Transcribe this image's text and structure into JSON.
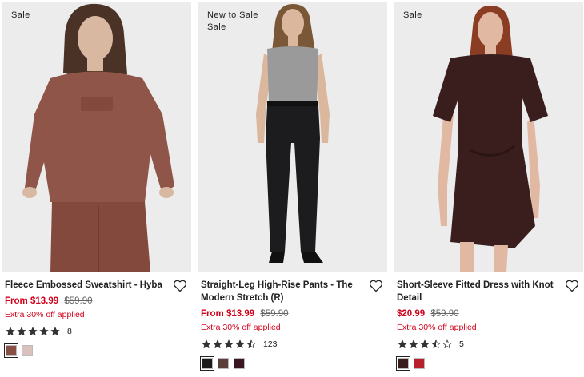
{
  "products": [
    {
      "badges": [
        "Sale"
      ],
      "title": "Fleece Embossed Sweatshirt - Hyba",
      "price_sale": "From $13.99",
      "price_original": "$59.90",
      "promo": "Extra 30% off applied",
      "rating": 5,
      "review_count": "8",
      "swatches": [
        "#8a4f44",
        "#d9c2bd"
      ],
      "image_icon": "model-photo",
      "colors": {
        "garment": "#8e5548",
        "skin": "#d9b8a2",
        "hair": "#4a3326"
      }
    },
    {
      "badges": [
        "New to Sale",
        "Sale"
      ],
      "title": "Straight-Leg High-Rise Pants - The Modern Stretch (R)",
      "price_sale": "From $13.99",
      "price_original": "$59.90",
      "promo": "Extra 30% off applied",
      "rating": 4.5,
      "review_count": "123",
      "swatches": [
        "#1a1a1a",
        "#5a3f38",
        "#3a1620"
      ],
      "image_icon": "model-photo",
      "colors": {
        "garment": "#1c1c1e",
        "top": "#9a9a9a",
        "skin": "#dbb79d",
        "hair": "#7a5736"
      }
    },
    {
      "badges": [
        "Sale"
      ],
      "title": "Short-Sleeve Fitted Dress with Knot Detail",
      "price_sale": "$20.99",
      "price_original": "$59.90",
      "promo": "Extra 30% off applied",
      "rating": 3.5,
      "review_count": "5",
      "swatches": [
        "#3b1a1c",
        "#b8202a"
      ],
      "image_icon": "model-photo",
      "colors": {
        "garment": "#3a1e1e",
        "skin": "#e1b9a2",
        "hair": "#8a3d22"
      }
    }
  ],
  "colors": {
    "sale_red": "#d0021b",
    "star": "#333333",
    "photo_bg": "#ececec"
  },
  "icons": {
    "wishlist": "heart-icon",
    "star": "star-icon"
  }
}
